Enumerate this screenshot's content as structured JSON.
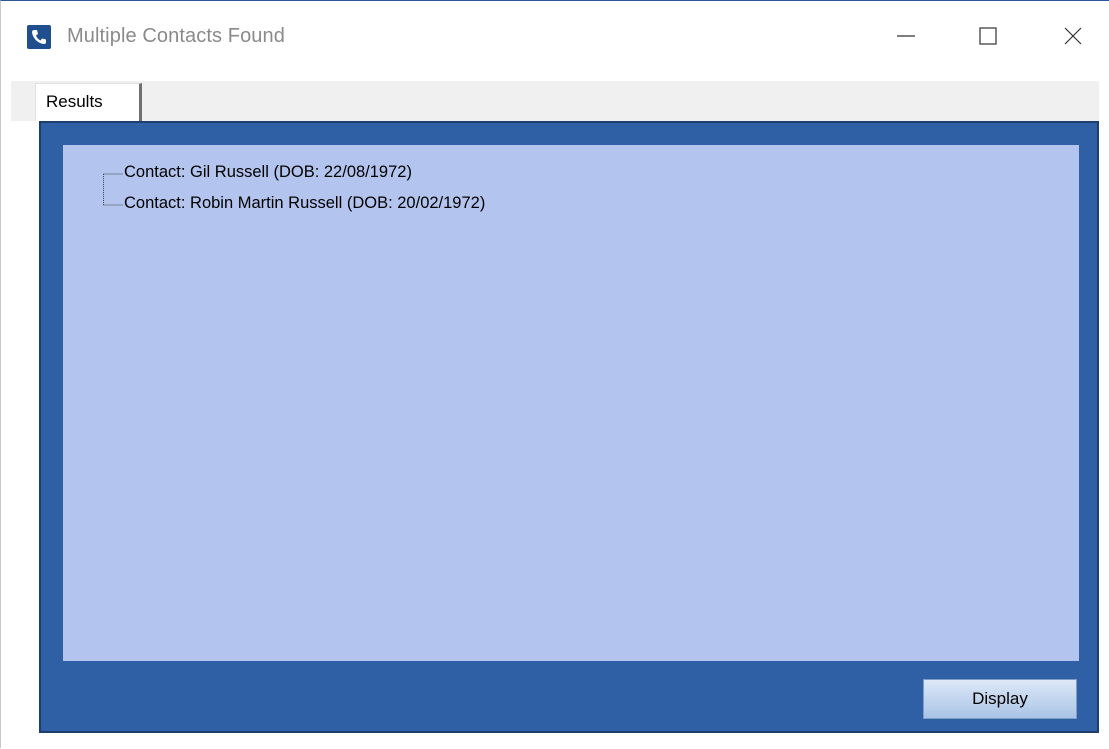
{
  "window": {
    "title": "Multiple Contacts Found",
    "icon": "phone-icon"
  },
  "titlebar_buttons": {
    "minimize": "minimize-icon",
    "maximize": "maximize-icon",
    "close": "close-icon"
  },
  "tabs": [
    {
      "label": "Results",
      "active": true
    }
  ],
  "results": {
    "items": [
      {
        "label": "Contact: Gil Russell (DOB: 22/08/1972)"
      },
      {
        "label": "Contact: Robin Martin Russell (DOB: 20/02/1972)"
      }
    ]
  },
  "actions": {
    "display_label": "Display"
  },
  "colors": {
    "panel": "#2f5fa5",
    "tree_background": "#b3c5ee",
    "title_text": "#8a8a8a"
  }
}
